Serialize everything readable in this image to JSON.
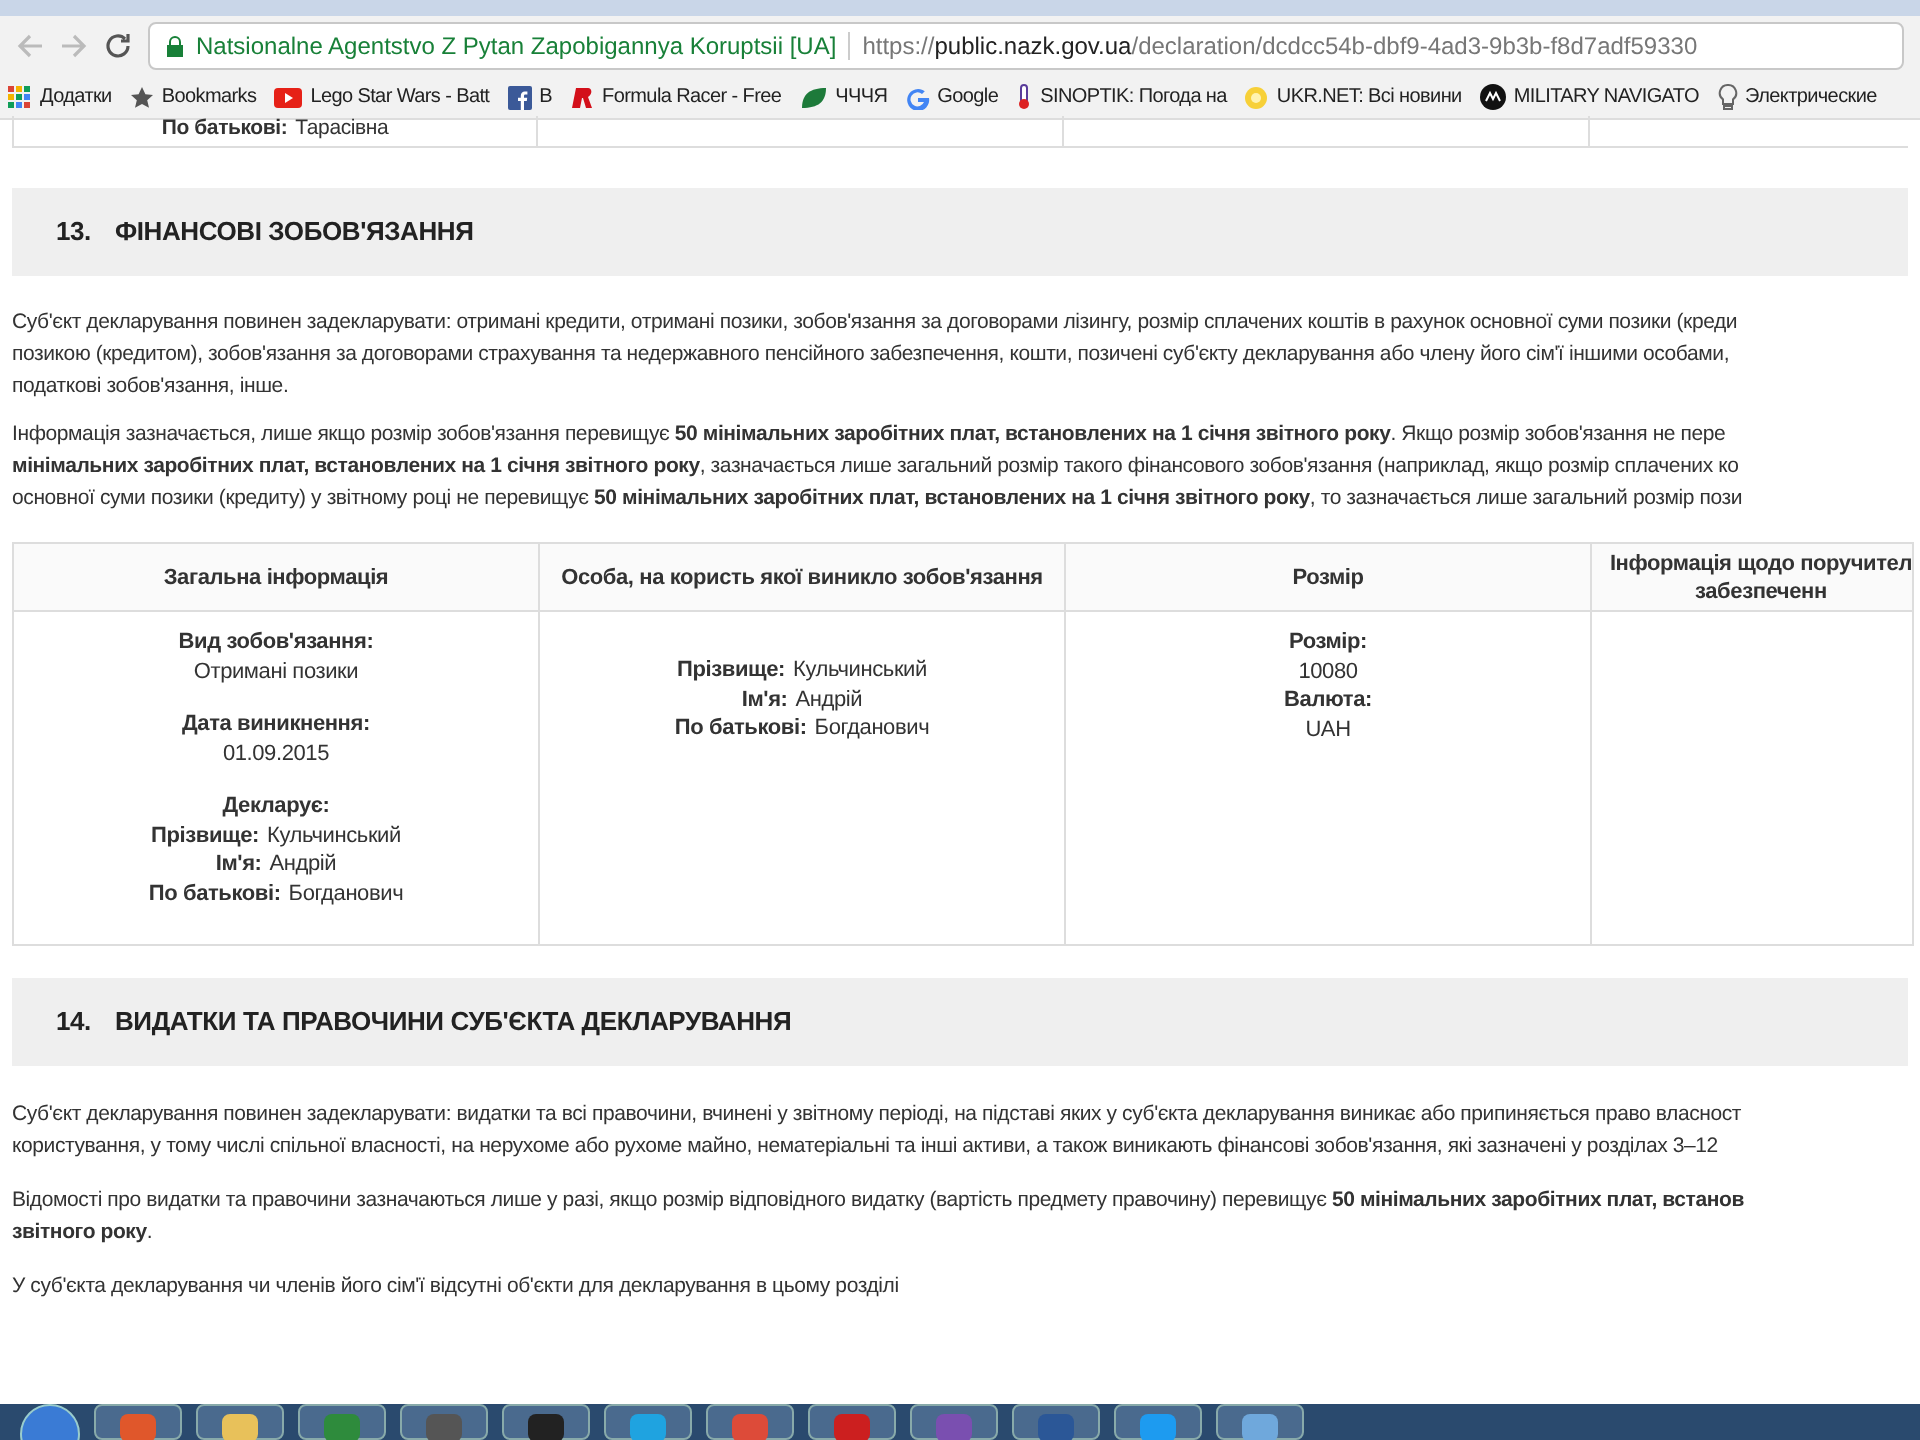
{
  "browser": {
    "site_title": "Natsionalne Agentstvo Z Pytan Zapobigannya Koruptsii [UA]",
    "url": {
      "scheme": "https://",
      "host": "public.nazk.gov.ua",
      "path": "/declaration/dcdcc54b-dbf9-4ad3-9b3b-f8d7adf59330"
    },
    "bookmarks": [
      {
        "kind": "apps",
        "label": "Додатки"
      },
      {
        "kind": "star",
        "label": "Bookmarks"
      },
      {
        "kind": "video",
        "label": "Lego Star Wars - Batt"
      },
      {
        "kind": "facebook",
        "label": "B"
      },
      {
        "kind": "racer",
        "label": "Formula Racer - Free"
      },
      {
        "kind": "leaf",
        "label": "ЧЧЧЯ"
      },
      {
        "kind": "google",
        "label": "Google"
      },
      {
        "kind": "thermometer",
        "label": "SINOPTIK: Погода на"
      },
      {
        "kind": "sun",
        "label": "UKR.NET: Всі новини"
      },
      {
        "kind": "badge",
        "label": "MILITARY NAVIGATO"
      },
      {
        "kind": "bulb",
        "label": "Электрические"
      }
    ]
  },
  "prev_row": {
    "label": "По батькові:",
    "value": "Тарасівна"
  },
  "section13": {
    "number": "13.",
    "title": "ФІНАНСОВІ ЗОБОВ'ЯЗАННЯ",
    "paragraphs": [
      [
        "Суб'єкт декларування повинен задекларувати: отримані кредити, отримані позики, зобов'язання за договорами лізингу, розмір сплачених коштів в рахунок основної суми позики (креди",
        "позикою (кредитом), зобов'язання за договорами страхування та недержавного пенсійного забезпечення, кошти, позичені суб'єкту декларування або члену його сім'ї іншими особами,",
        "податкові зобов'язання, інше."
      ],
      [
        "Інформація зазначається, лише якщо розмір зобов'язання перевищує **50 мінімальних заробітних плат, встановлених на 1 січня звітного року**. Якщо розмір зобов'язання не пере",
        "**мінімальних заробітних плат, встановлених на 1 січня звітного року**, зазначається лише загальний розмір такого фінансового зобов'язання (наприклад, якщо розмір сплачених ко",
        "основної суми позики (кредиту) у звітному році не перевищує **50 мінімальних заробітних плат, встановлених на 1 січня звітного року**, то зазначається лише загальний розмір пози"
      ]
    ],
    "table": {
      "columns": [
        "Загальна інформація",
        "Особа, на користь якої виникло зобов'язання",
        "Розмір",
        "Інформація щодо поручител\nзабезпеченн"
      ],
      "rows": [
        [
          [
            [
              {
                "kind": "stacked",
                "label": "Вид зобов'язання:",
                "value": "Отримані позики"
              }
            ],
            [
              {
                "kind": "stacked",
                "label": "Дата виникнення:",
                "value": "01.09.2015"
              }
            ],
            [
              {
                "kind": "heading",
                "label": "Декларує:"
              },
              {
                "kind": "inline",
                "label": "Прізвище:",
                "value": "Кульчинський"
              },
              {
                "kind": "inline",
                "label": "Ім'я:",
                "value": "Андрій"
              },
              {
                "kind": "inline",
                "label": "По батькові:",
                "value": "Богданович"
              }
            ]
          ],
          [
            [
              {
                "kind": "inline",
                "label": "Прізвище:",
                "value": "Кульчинський"
              },
              {
                "kind": "inline",
                "label": "Ім'я:",
                "value": "Андрій"
              },
              {
                "kind": "inline",
                "label": "По батькові:",
                "value": "Богданович"
              }
            ]
          ],
          [
            [
              {
                "kind": "stacked",
                "label": "Розмір:",
                "value": "10080"
              },
              {
                "kind": "stacked",
                "label": "Валюта:",
                "value": "UAH"
              }
            ]
          ],
          []
        ]
      ]
    }
  },
  "section14": {
    "number": "14.",
    "title": "ВИДАТКИ ТА ПРАВОЧИНИ СУБ'ЄКТА ДЕКЛАРУВАННЯ",
    "paragraphs": [
      [
        "Суб'єкт декларування повинен задекларувати: видатки та всі правочини, вчинені у звітному періоді, на підставі яких у суб'єкта декларування виникає або припиняється право власност",
        "користування, у тому числі спільної власності, на нерухоме або рухоме майно, нематеріальні та інші активи, а також виникають фінансові зобов'язання, які зазначені у розділах 3–12"
      ],
      [
        "Відомості про видатки та правочини зазначаються лише у разі, якщо розмір відповідного видатку (вартість предмету правочину) перевищує **50 мінімальних заробітних плат, встанов**",
        "**звітного року**."
      ],
      [
        "У суб'єкта декларування чи членів його сім'ї відсутні об'єкти для декларування в цьому розділі"
      ]
    ]
  },
  "taskbar": {
    "apps": [
      {
        "color": "#e0572b"
      },
      {
        "color": "#e8c15a"
      },
      {
        "color": "#2e8b3c"
      },
      {
        "color": "#555555"
      },
      {
        "color": "#222222"
      },
      {
        "color": "#1fa3e0"
      },
      {
        "color": "#dd4b39"
      },
      {
        "color": "#cc1f1f"
      },
      {
        "color": "#7a4fb0"
      },
      {
        "color": "#2b5797"
      },
      {
        "color": "#1d9bf0"
      },
      {
        "color": "#6fa8dc"
      }
    ]
  }
}
